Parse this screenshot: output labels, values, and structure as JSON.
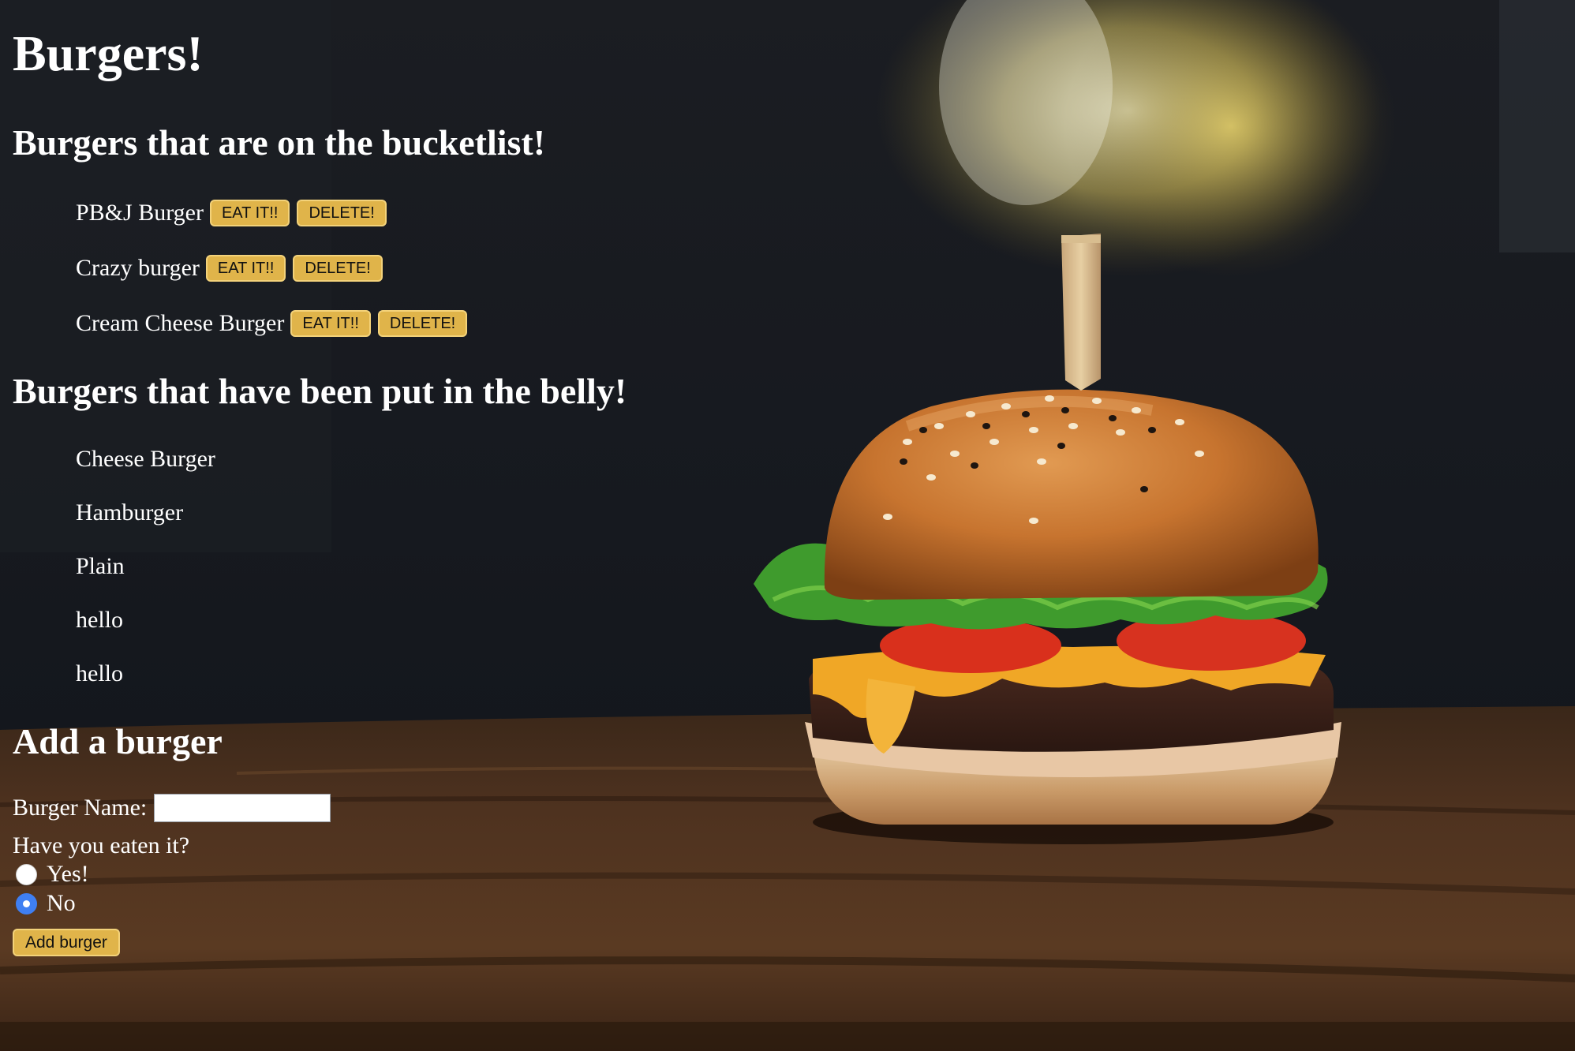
{
  "page": {
    "title": "Burgers!"
  },
  "bucketlist": {
    "heading": "Burgers that are on the bucketlist!",
    "items": [
      {
        "name": "PB&J Burger",
        "eat_label": "EAT IT!!",
        "delete_label": "DELETE!"
      },
      {
        "name": "Crazy burger",
        "eat_label": "EAT IT!!",
        "delete_label": "DELETE!"
      },
      {
        "name": "Cream Cheese Burger",
        "eat_label": "EAT IT!!",
        "delete_label": "DELETE!"
      }
    ]
  },
  "belly": {
    "heading": "Burgers that have been put in the belly!",
    "items": [
      "Cheese Burger",
      "Hamburger",
      "Plain",
      "hello",
      "hello"
    ]
  },
  "add_form": {
    "heading": "Add a burger",
    "name_label": "Burger Name:",
    "name_value": "",
    "eaten_question": "Have you eaten it?",
    "options": [
      {
        "label": "Yes!",
        "checked": false
      },
      {
        "label": "No",
        "checked": true
      }
    ],
    "submit_label": "Add burger"
  },
  "colors": {
    "button_bg": "#e0b44a",
    "radio_checked": "#3f7ff2",
    "background_dark": "#15181f",
    "table_wood": "#4a2e1c"
  }
}
